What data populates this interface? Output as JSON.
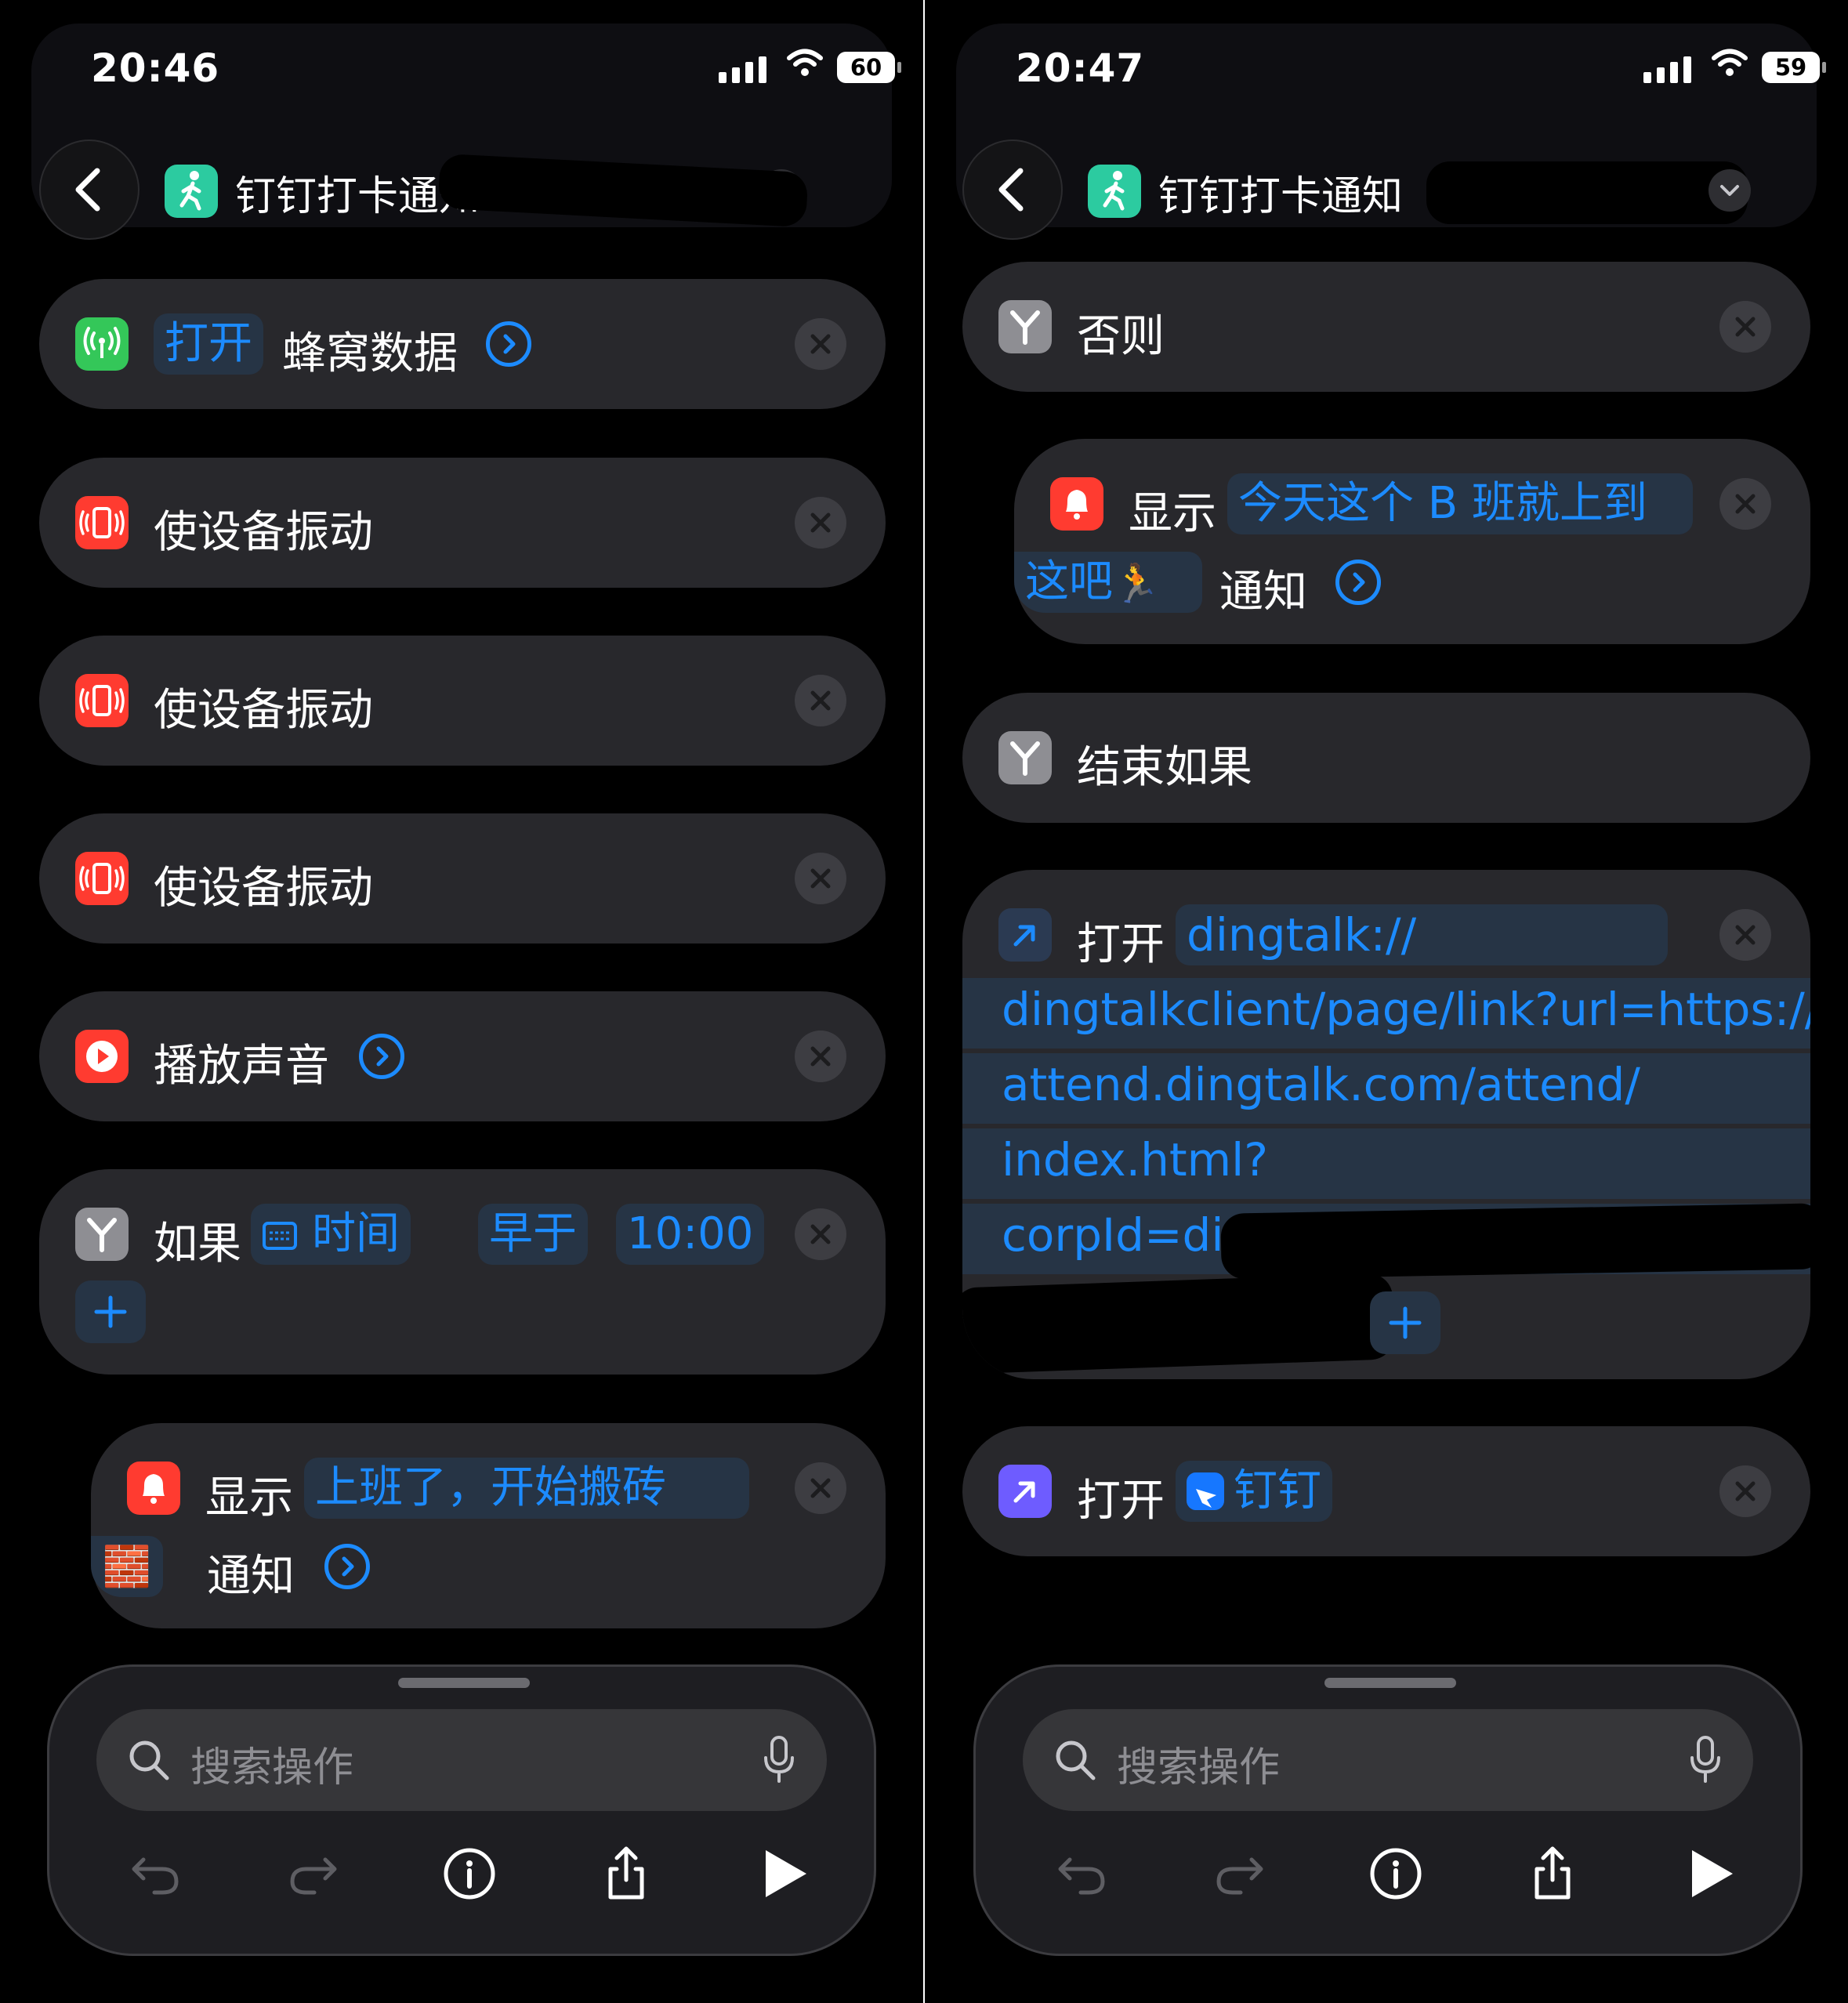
{
  "screens": [
    {
      "status": {
        "time": "20:46",
        "battery": "60"
      },
      "nav": {
        "title": "钉钉打卡通知"
      },
      "actions": [
        {
          "verb": "打开",
          "text": "蜂窝数据"
        },
        {
          "text": "使设备振动"
        },
        {
          "text": "使设备振动"
        },
        {
          "text": "使设备振动"
        },
        {
          "text": "播放声音"
        },
        {
          "label": "如果",
          "var": "时间",
          "cond": "早于",
          "value": "10:00"
        },
        {
          "label": "显示",
          "message": "上班了，开始搬砖",
          "emoji": "🧱",
          "suffix": "通知"
        }
      ],
      "toolbar": {
        "search_placeholder": "搜索操作"
      }
    },
    {
      "status": {
        "time": "20:47",
        "battery": "59"
      },
      "nav": {
        "title": "钉钉打卡通知"
      },
      "actions": [
        {
          "text": "否则"
        },
        {
          "label": "显示",
          "message_line1": "今天这个 B 班就上到",
          "message_line2": "这吧",
          "emoji": "🏃",
          "suffix": "通知"
        },
        {
          "text": "结束如果"
        },
        {
          "verb": "打开",
          "url_lines": [
            "dingtalk://",
            "dingtalkclient/page/link?url=https://",
            "attend.dingtalk.com/attend/",
            "index.html?",
            "corpId=ding"
          ]
        },
        {
          "verb": "打开",
          "app": "钉钉"
        }
      ],
      "toolbar": {
        "search_placeholder": "搜索操作"
      }
    }
  ],
  "colors": {
    "accent": "#1c8bff",
    "card": "#28282c",
    "token_bg": "#263445",
    "green": "#34c759",
    "red": "#ff3b30",
    "gray_icon": "#8e8e93",
    "purple": "#6e5cff",
    "teal": "#2ccba0"
  },
  "icons": [
    "back-chevron-icon",
    "walking-person-icon",
    "cellular-antenna-icon",
    "vibrate-phone-icon",
    "play-icon",
    "branch-y-icon",
    "calendar-icon",
    "bell-icon",
    "arrow-up-right-icon",
    "dingtalk-logo-icon",
    "search-icon",
    "microphone-icon",
    "undo-icon",
    "redo-icon",
    "info-icon",
    "share-icon",
    "run-play-icon",
    "chevron-down-icon",
    "close-x-icon",
    "circle-chevron-right-icon",
    "plus-icon"
  ]
}
